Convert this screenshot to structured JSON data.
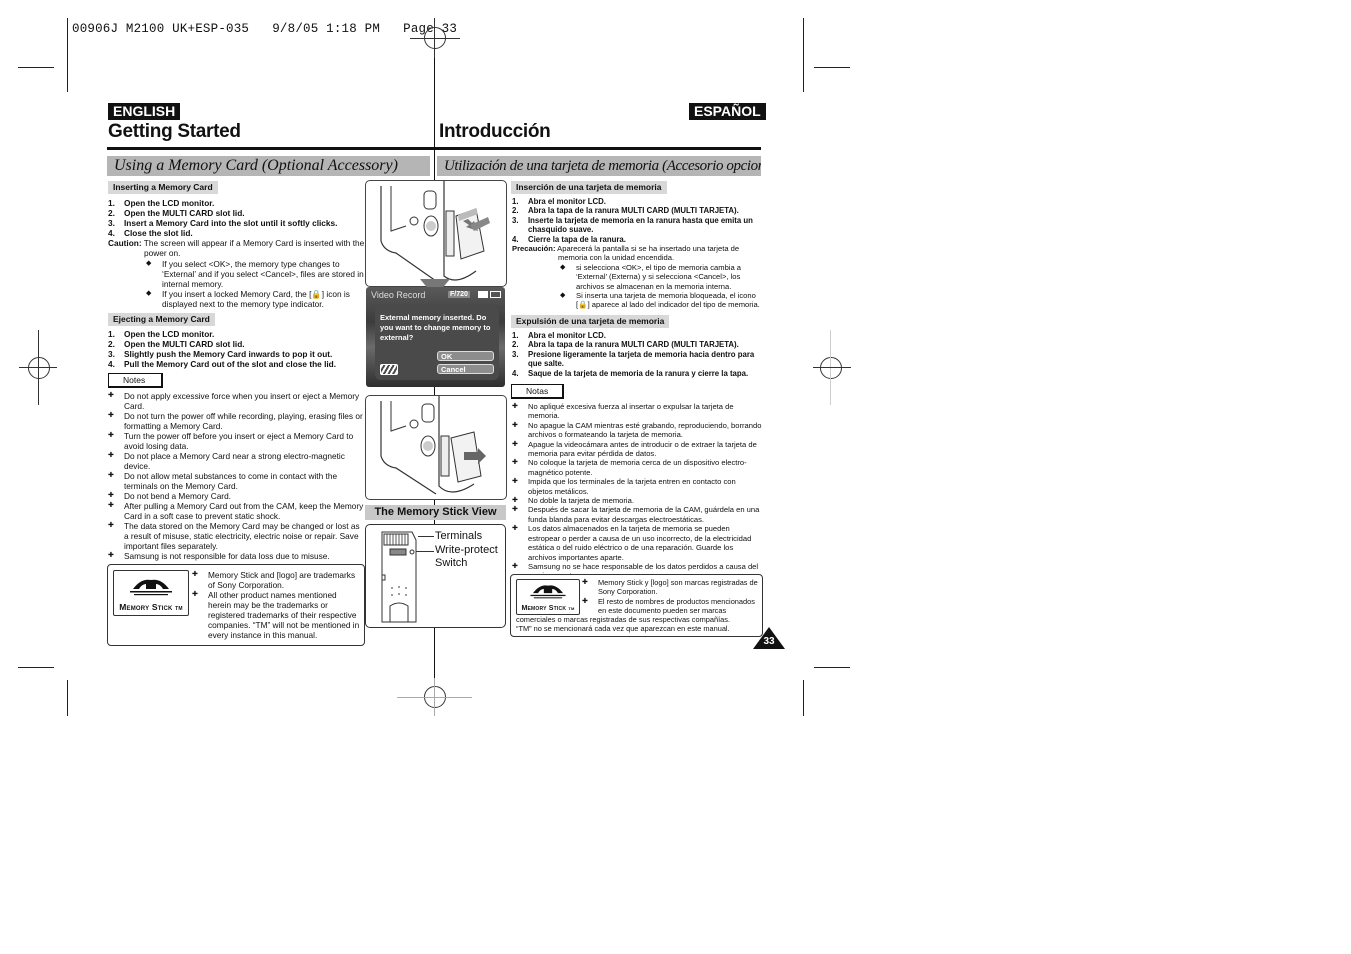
{
  "slug": "00906J M2100 UK+ESP-035   9/8/05 1:18 PM   Page 33",
  "english": {
    "lang_tab": "ENGLISH",
    "title": "Getting Started",
    "section": "Using a Memory Card (Optional Accessory)",
    "inserting": {
      "heading": "Inserting a Memory Card",
      "steps": [
        {
          "n": "1.",
          "text": "Open the LCD monitor."
        },
        {
          "n": "2.",
          "text": "Open the MULTI CARD slot lid."
        },
        {
          "n": "3.",
          "text": "Insert a Memory Card into the slot until it softly clicks."
        },
        {
          "n": "4.",
          "text": "Close the slot lid."
        }
      ],
      "caution_label": "Caution:",
      "caution_text": " The screen will appear if a Memory Card is inserted with the power on.",
      "bullets": [
        "If you select <OK>, the memory type changes to ‘External’ and if you select <Cancel>, files are stored in internal memory.",
        "If you insert a locked Memory Card, the [🔒] icon is displayed next to the memory type indicator."
      ]
    },
    "ejecting": {
      "heading": "Ejecting a Memory Card",
      "steps": [
        {
          "n": "1.",
          "text": "Open the LCD monitor."
        },
        {
          "n": "2.",
          "text": "Open the MULTI CARD slot lid."
        },
        {
          "n": "3.",
          "text": "Slightly push the Memory Card inwards to pop it out."
        },
        {
          "n": "4.",
          "text": "Pull the Memory Card out of the slot and close the lid."
        }
      ]
    },
    "notes_label": "Notes",
    "notes": [
      "Do not apply excessive force when you insert or eject a Memory Card.",
      "Do not turn the power off while recording, playing, erasing files or formatting a Memory Card.",
      "Turn the power off before you insert or eject a Memory Card to avoid losing data.",
      "Do not place a Memory Card near a strong electro-magnetic device.",
      "Do not allow metal substances to come in contact with the terminals on the Memory Card.",
      "Do not bend a Memory Card.",
      "After pulling a Memory Card out from the CAM, keep the Memory Card in a soft case to prevent static shock.",
      "The data stored on the Memory Card may be changed or lost as a result of misuse, static electricity, electric noise or repair. Save important files separately.",
      "Samsung is not responsible for data loss due to misuse."
    ],
    "trademark": [
      "Memory Stick and [logo] are trademarks of Sony Corporation.",
      "All other product names mentioned herein may be the trademarks or registered trademarks of their respective companies. “TM” will not be mentioned in every instance in this manual."
    ]
  },
  "center": {
    "lcd": {
      "mode": "Video Record",
      "counter": "F/720",
      "message": "External memory inserted. Do you want to change memory to external?",
      "ok_label": "OK",
      "cancel_label": "Cancel"
    },
    "memory_stick_view": {
      "heading": "The Memory Stick View",
      "label_terminals": "Terminals",
      "label_write_protect": "Write-protect",
      "label_switch": "Switch"
    },
    "ms_logo_word": "Memory Stick",
    "ms_logo_tm": "TM"
  },
  "spanish": {
    "lang_tab": "ESPAÑOL",
    "title": "Introducción",
    "section": "Utilización de una tarjeta de memoria (Accesorio opcional)",
    "inserting": {
      "heading": "Inserción de una tarjeta de memoria",
      "steps": [
        {
          "n": "1.",
          "text": "Abra el monitor LCD."
        },
        {
          "n": "2.",
          "text": "Abra la tapa de la ranura MULTI CARD (MULTI TARJETA)."
        },
        {
          "n": "3.",
          "text": "Inserte la tarjeta de memoria en la ranura hasta que emita un chasquido suave."
        },
        {
          "n": "4.",
          "text": "Cierre la tapa de la ranura."
        }
      ],
      "caution_label": "Precaución:",
      "caution_text": " Aparecerá la pantalla si se ha insertado una tarjeta de memoria con la unidad encendida.",
      "bullets": [
        "si selecciona <OK>, el tipo de memoria cambia a ‘External’ (Externa) y si selecciona <Cancel>, los archivos se almacenan en la memoria interna.",
        "Si inserta una tarjeta de memoria bloqueada, el icono [🔒] aparece al lado del indicador del tipo de memoria."
      ]
    },
    "ejecting": {
      "heading": "Expulsión de una tarjeta de memoria",
      "steps": [
        {
          "n": "1.",
          "text": "Abra el monitor LCD."
        },
        {
          "n": "2.",
          "text": "Abra la tapa de la ranura MULTI CARD (MULTI TARJETA)."
        },
        {
          "n": "3.",
          "text": "Presione ligeramente la tarjeta de memoria hacia dentro para que salte."
        },
        {
          "n": "4.",
          "text": "Saque de la tarjeta de memoria de la ranura y cierre la tapa."
        }
      ]
    },
    "notes_label": "Notas",
    "notes": [
      "No apliqué excesiva fuerza al insertar o expulsar la tarjeta de memoria.",
      "No apague la CAM  mientras esté grabando, reproduciendo, borrando archivos o formateando la tarjeta de memoria.",
      "Apague la videocámara antes de introducir o de extraer la tarjeta de memoria para evitar pérdida de datos.",
      "No coloque la tarjeta de memoria cerca de un dispositivo electro-magnético potente.",
      "Impida que los terminales de la tarjeta entren en contacto con objetos metálicos.",
      "No doble la tarjeta de memoria.",
      "Después de sacar la tarjeta de memoria de la CAM, guárdela en una funda blanda para evitar descargas electroestáticas.",
      "Los datos almacenados en la tarjeta de memoria se pueden estropear o perder a causa de un uso incorrecto, de la electricidad estática o del ruido eléctrico o de una reparación. Guarde los archivos importantes aparte.",
      "Samsung no se hace responsable de los datos perdidos a causa del uso incorrecto."
    ],
    "trademark": [
      "Memory Stick y [logo] son marcas registradas de Sony Corporation.",
      "El resto de nombres de productos mencionados en este documento pueden ser marcas",
      "comerciales o marcas registradas de sus respectivas compañías.",
      "“TM” no se mencionará cada vez que aparezcan en este manual."
    ]
  },
  "page_number": "33"
}
